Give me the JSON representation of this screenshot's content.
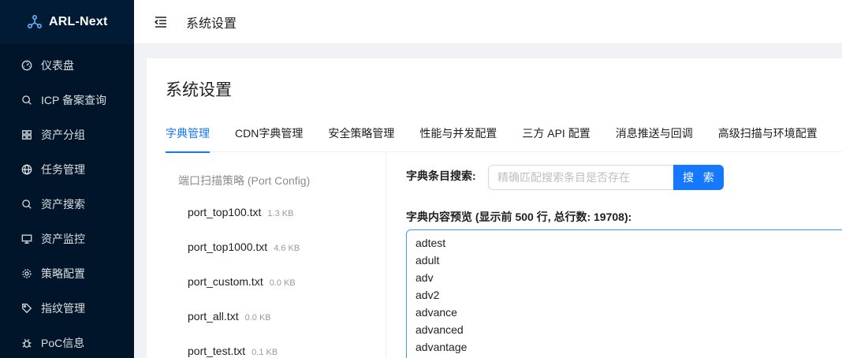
{
  "app": {
    "name": "ARL-Next"
  },
  "sidebar": {
    "items": [
      {
        "label": "仪表盘",
        "icon": "dashboard-icon"
      },
      {
        "label": "ICP 备案查询",
        "icon": "search-icon"
      },
      {
        "label": "资产分组",
        "icon": "appstore-icon"
      },
      {
        "label": "任务管理",
        "icon": "global-icon"
      },
      {
        "label": "资产搜索",
        "icon": "search-icon"
      },
      {
        "label": "资产监控",
        "icon": "desktop-icon"
      },
      {
        "label": "策略配置",
        "icon": "gear-icon"
      },
      {
        "label": "指纹管理",
        "icon": "tag-icon"
      },
      {
        "label": "PoC信息",
        "icon": "bug-icon"
      }
    ]
  },
  "header": {
    "title": "系统设置"
  },
  "page": {
    "title": "系统设置"
  },
  "tabs": [
    {
      "label": "字典管理",
      "active": true
    },
    {
      "label": "CDN字典管理",
      "active": false
    },
    {
      "label": "安全策略管理",
      "active": false
    },
    {
      "label": "性能与并发配置",
      "active": false
    },
    {
      "label": "三方 API 配置",
      "active": false
    },
    {
      "label": "消息推送与回调",
      "active": false
    },
    {
      "label": "高级扫描与环境配置",
      "active": false
    }
  ],
  "file_group": {
    "title": "端口扫描策略 (Port Config)",
    "files": [
      {
        "name": "port_top100.txt",
        "size": "1.3 KB"
      },
      {
        "name": "port_top1000.txt",
        "size": "4.6 KB"
      },
      {
        "name": "port_custom.txt",
        "size": "0.0 KB"
      },
      {
        "name": "port_all.txt",
        "size": "0.0 KB"
      },
      {
        "name": "port_test.txt",
        "size": "0.1 KB"
      }
    ]
  },
  "search": {
    "label": "字典条目搜索:",
    "placeholder": "精确匹配搜索条目是否存在",
    "value": "",
    "button_label": "搜 索"
  },
  "preview": {
    "label": "字典内容预览 (显示前 500 行, 总行数: 19708):",
    "lines": [
      "adtest",
      "adult",
      "adv",
      "adv2",
      "advance",
      "advanced",
      "advantage"
    ]
  },
  "colors": {
    "accent": "#1677ff",
    "sidebar_bg": "#001529"
  }
}
